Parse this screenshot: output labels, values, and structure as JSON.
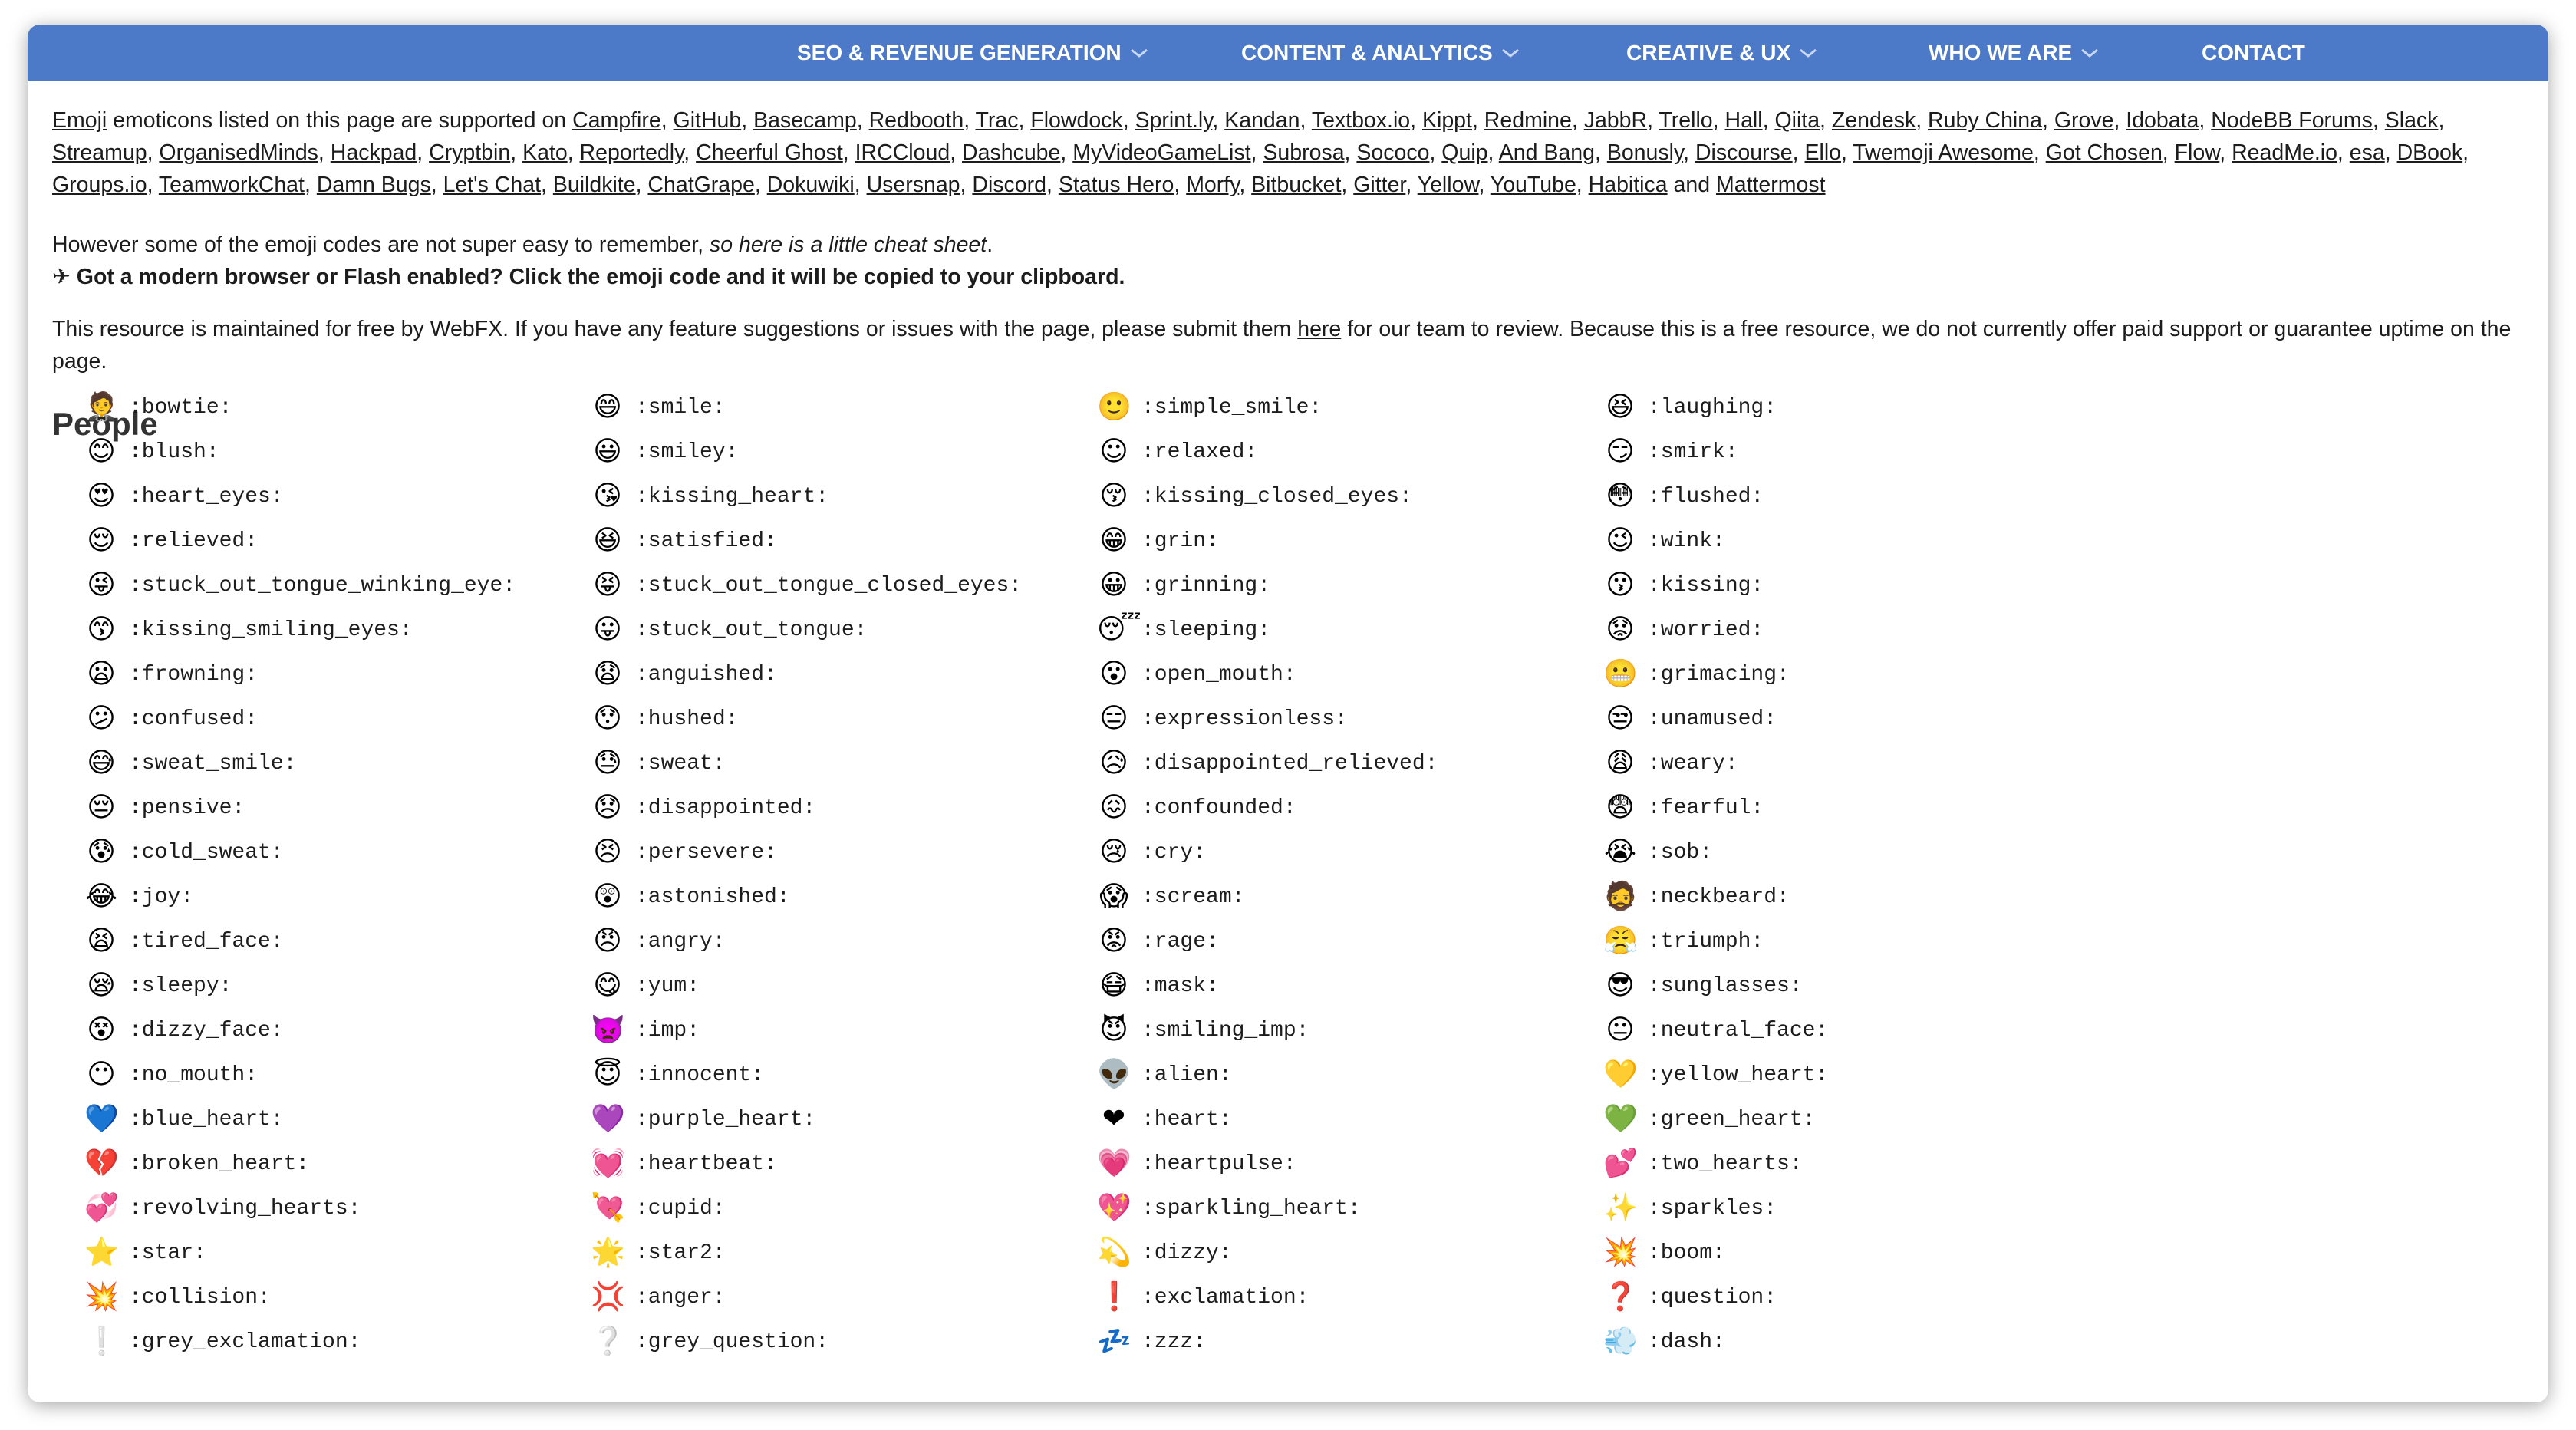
{
  "nav": [
    {
      "label": "SEO & REVENUE GENERATION",
      "dropdown": true
    },
    {
      "label": "CONTENT & ANALYTICS",
      "dropdown": true
    },
    {
      "label": "CREATIVE & UX",
      "dropdown": true
    },
    {
      "label": "WHO WE ARE",
      "dropdown": true
    },
    {
      "label": "CONTACT",
      "dropdown": false
    }
  ],
  "intro": {
    "emoji_link": "Emoji",
    "text_before": " emoticons listed on this page are supported on ",
    "services": [
      "Campfire",
      "GitHub",
      "Basecamp",
      "Redbooth",
      "Trac",
      "Flowdock",
      "Sprint.ly",
      "Kandan",
      "Textbox.io",
      "Kippt",
      "Redmine",
      "JabbR",
      "Trello",
      "Hall",
      "Qiita",
      "Zendesk",
      "Ruby China",
      "Grove",
      "Idobata",
      "NodeBB Forums",
      "Slack",
      "Streamup",
      "OrganisedMinds",
      "Hackpad",
      "Cryptbin",
      "Kato",
      "Reportedly",
      "Cheerful Ghost",
      "IRCCloud",
      "Dashcube",
      "MyVideoGameList",
      "Subrosa",
      "Sococo",
      "Quip",
      "And Bang",
      "Bonusly",
      "Discourse",
      "Ello",
      "Twemoji Awesome",
      "Got Chosen",
      "Flow",
      "ReadMe.io",
      "esa",
      "DBook",
      "Groups.io",
      "TeamworkChat",
      "Damn Bugs",
      "Let's Chat",
      "Buildkite",
      "ChatGrape",
      "Dokuwiki",
      "Usersnap",
      "Discord",
      "Status Hero",
      "Morfy",
      "Bitbucket",
      "Gitter",
      "Yellow",
      "YouTube",
      "Habitica"
    ],
    "and_word": " and ",
    "last_service": "Mattermost"
  },
  "cheat": {
    "text": "However some of the emoji codes are not super easy to remember, ",
    "italic": "so here is a little cheat sheet",
    "end": "."
  },
  "copy_tip": "✈ Got a modern browser or Flash enabled? Click the emoji code and it will be copied to your clipboard.",
  "maintenance": {
    "before": "This resource is maintained for free by WebFX. If you have any feature suggestions or issues with the page, please submit them ",
    "link": "here",
    "after": " for our team to review. Because this is a free resource, we do not currently offer paid support or guarantee uptime on the page."
  },
  "section_title": "People",
  "emojis": [
    {
      "code": ":bowtie:",
      "emoji": "🤵"
    },
    {
      "code": ":smile:",
      "emoji": "😄"
    },
    {
      "code": ":simple_smile:",
      "emoji": "🙂"
    },
    {
      "code": ":laughing:",
      "emoji": "😆"
    },
    {
      "code": ":blush:",
      "emoji": "😊"
    },
    {
      "code": ":smiley:",
      "emoji": "😃"
    },
    {
      "code": ":relaxed:",
      "emoji": "☺"
    },
    {
      "code": ":smirk:",
      "emoji": "😏"
    },
    {
      "code": ":heart_eyes:",
      "emoji": "😍"
    },
    {
      "code": ":kissing_heart:",
      "emoji": "😘"
    },
    {
      "code": ":kissing_closed_eyes:",
      "emoji": "😚"
    },
    {
      "code": ":flushed:",
      "emoji": "😳"
    },
    {
      "code": ":relieved:",
      "emoji": "😌"
    },
    {
      "code": ":satisfied:",
      "emoji": "😆"
    },
    {
      "code": ":grin:",
      "emoji": "😁"
    },
    {
      "code": ":wink:",
      "emoji": "😉"
    },
    {
      "code": ":stuck_out_tongue_winking_eye:",
      "emoji": "😜"
    },
    {
      "code": ":stuck_out_tongue_closed_eyes:",
      "emoji": "😝"
    },
    {
      "code": ":grinning:",
      "emoji": "😀"
    },
    {
      "code": ":kissing:",
      "emoji": "😗"
    },
    {
      "code": ":kissing_smiling_eyes:",
      "emoji": "😙"
    },
    {
      "code": ":stuck_out_tongue:",
      "emoji": "😛"
    },
    {
      "code": ":sleeping:",
      "emoji": "😴"
    },
    {
      "code": ":worried:",
      "emoji": "😟"
    },
    {
      "code": ":frowning:",
      "emoji": "😦"
    },
    {
      "code": ":anguished:",
      "emoji": "😧"
    },
    {
      "code": ":open_mouth:",
      "emoji": "😮"
    },
    {
      "code": ":grimacing:",
      "emoji": "😬"
    },
    {
      "code": ":confused:",
      "emoji": "😕"
    },
    {
      "code": ":hushed:",
      "emoji": "😯"
    },
    {
      "code": ":expressionless:",
      "emoji": "😑"
    },
    {
      "code": ":unamused:",
      "emoji": "😒"
    },
    {
      "code": ":sweat_smile:",
      "emoji": "😅"
    },
    {
      "code": ":sweat:",
      "emoji": "😓"
    },
    {
      "code": ":disappointed_relieved:",
      "emoji": "😥"
    },
    {
      "code": ":weary:",
      "emoji": "😩"
    },
    {
      "code": ":pensive:",
      "emoji": "😔"
    },
    {
      "code": ":disappointed:",
      "emoji": "😞"
    },
    {
      "code": ":confounded:",
      "emoji": "😖"
    },
    {
      "code": ":fearful:",
      "emoji": "😨"
    },
    {
      "code": ":cold_sweat:",
      "emoji": "😰"
    },
    {
      "code": ":persevere:",
      "emoji": "😣"
    },
    {
      "code": ":cry:",
      "emoji": "😢"
    },
    {
      "code": ":sob:",
      "emoji": "😭"
    },
    {
      "code": ":joy:",
      "emoji": "😂"
    },
    {
      "code": ":astonished:",
      "emoji": "😲"
    },
    {
      "code": ":scream:",
      "emoji": "😱"
    },
    {
      "code": ":neckbeard:",
      "emoji": "🧔"
    },
    {
      "code": ":tired_face:",
      "emoji": "😫"
    },
    {
      "code": ":angry:",
      "emoji": "😠"
    },
    {
      "code": ":rage:",
      "emoji": "😡"
    },
    {
      "code": ":triumph:",
      "emoji": "😤"
    },
    {
      "code": ":sleepy:",
      "emoji": "😪"
    },
    {
      "code": ":yum:",
      "emoji": "😋"
    },
    {
      "code": ":mask:",
      "emoji": "😷"
    },
    {
      "code": ":sunglasses:",
      "emoji": "😎"
    },
    {
      "code": ":dizzy_face:",
      "emoji": "😵"
    },
    {
      "code": ":imp:",
      "emoji": "👿"
    },
    {
      "code": ":smiling_imp:",
      "emoji": "😈"
    },
    {
      "code": ":neutral_face:",
      "emoji": "😐"
    },
    {
      "code": ":no_mouth:",
      "emoji": "😶"
    },
    {
      "code": ":innocent:",
      "emoji": "😇"
    },
    {
      "code": ":alien:",
      "emoji": "👽"
    },
    {
      "code": ":yellow_heart:",
      "emoji": "💛"
    },
    {
      "code": ":blue_heart:",
      "emoji": "💙"
    },
    {
      "code": ":purple_heart:",
      "emoji": "💜"
    },
    {
      "code": ":heart:",
      "emoji": "❤"
    },
    {
      "code": ":green_heart:",
      "emoji": "💚"
    },
    {
      "code": ":broken_heart:",
      "emoji": "💔"
    },
    {
      "code": ":heartbeat:",
      "emoji": "💓"
    },
    {
      "code": ":heartpulse:",
      "emoji": "💗"
    },
    {
      "code": ":two_hearts:",
      "emoji": "💕"
    },
    {
      "code": ":revolving_hearts:",
      "emoji": "💞"
    },
    {
      "code": ":cupid:",
      "emoji": "💘"
    },
    {
      "code": ":sparkling_heart:",
      "emoji": "💖"
    },
    {
      "code": ":sparkles:",
      "emoji": "✨"
    },
    {
      "code": ":star:",
      "emoji": "⭐"
    },
    {
      "code": ":star2:",
      "emoji": "🌟"
    },
    {
      "code": ":dizzy:",
      "emoji": "💫"
    },
    {
      "code": ":boom:",
      "emoji": "💥"
    },
    {
      "code": ":collision:",
      "emoji": "💥"
    },
    {
      "code": ":anger:",
      "emoji": "💢"
    },
    {
      "code": ":exclamation:",
      "emoji": "❗"
    },
    {
      "code": ":question:",
      "emoji": "❓"
    },
    {
      "code": ":grey_exclamation:",
      "emoji": "❕"
    },
    {
      "code": ":grey_question:",
      "emoji": "❔"
    },
    {
      "code": ":zzz:",
      "emoji": "💤"
    },
    {
      "code": ":dash:",
      "emoji": "💨"
    }
  ],
  "colors": {
    "navbar": "#4c7ac9",
    "nav_text": "#ffffff",
    "body_text": "#1c1c1c",
    "heading": "#333333"
  }
}
